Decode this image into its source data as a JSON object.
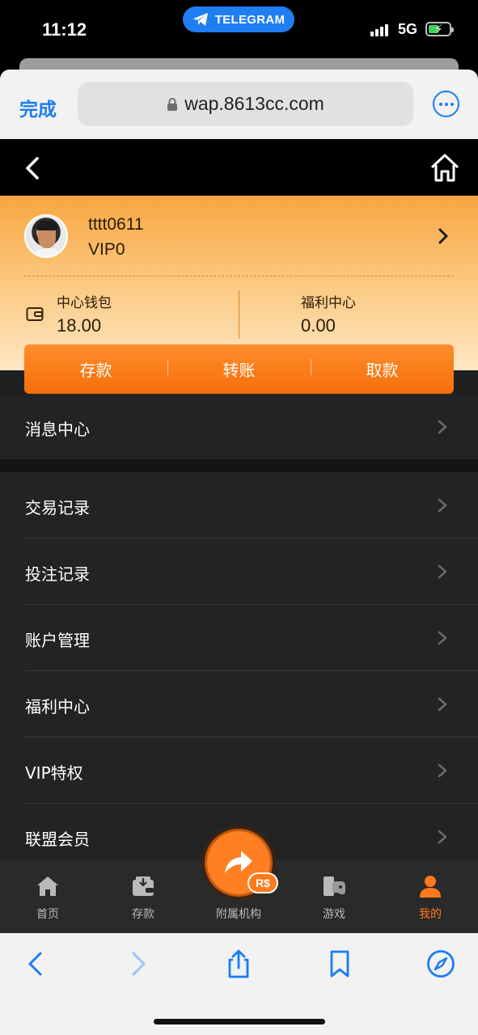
{
  "status_bar": {
    "time": "11:12",
    "pill_label": "TELEGRAM",
    "network": "5G"
  },
  "browser": {
    "done_label": "完成",
    "url": "wap.8613cc.com"
  },
  "profile": {
    "username": "tttt0611",
    "vip_level": "VIP0",
    "wallet": {
      "label": "中心钱包",
      "value": "18.00"
    },
    "welfare": {
      "label": "福利中心",
      "value": "0.00"
    }
  },
  "actions": [
    "存款",
    "转账",
    "取款"
  ],
  "menu": {
    "messages": "消息中心",
    "items": [
      "交易记录",
      "投注记录",
      "账户管理",
      "福利中心",
      "VIP特权",
      "联盟会员"
    ]
  },
  "tabbar": {
    "home": "首页",
    "deposit": "存款",
    "affiliate": "附属机构",
    "affiliate_badge": "R$",
    "games": "游戏",
    "mine": "我的"
  },
  "colors": {
    "accent": "#ff7a1a",
    "browser_blue": "#1a7cf2",
    "telegram_blue": "#1f7ef2"
  },
  "icons": [
    "back-icon",
    "house-icon",
    "wallet-icon",
    "chevron-right-icon",
    "home-tab-icon",
    "deposit-tab-icon",
    "share-arrow-icon",
    "gamepad-icon",
    "user-icon",
    "safari-back-icon",
    "safari-forward-icon",
    "share-icon",
    "bookmarks-icon",
    "compass-icon",
    "lock-icon",
    "telegram-icon"
  ]
}
